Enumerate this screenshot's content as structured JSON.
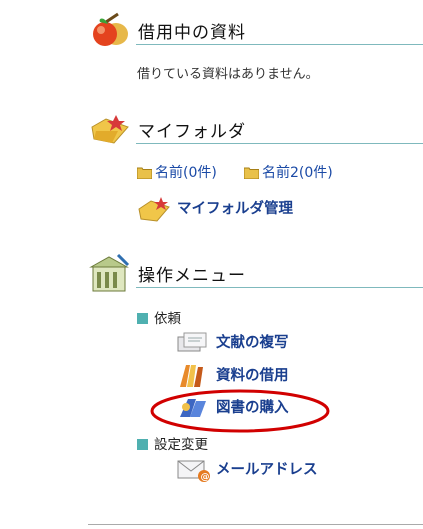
{
  "loans": {
    "title": "借用中の資料",
    "note": "借りている資料はありません。"
  },
  "myfolder": {
    "title": "マイフォルダ",
    "folders": [
      "名前(0件)",
      "名前2(0件)"
    ],
    "manage_label": "マイフォルダ管理"
  },
  "menu": {
    "title": "操作メニュー",
    "request_label": "依頼",
    "request_items": [
      "文献の複写",
      "資料の借用",
      "図書の購入"
    ],
    "settings_label": "設定変更",
    "settings_items": [
      "メールアドレス"
    ]
  },
  "highlight_color": "#d10000",
  "accent_color": "#4fb0b0",
  "icons": [
    "apple-pencil-icon",
    "folder-star-icon",
    "building-icon",
    "folder-icon",
    "documents-icon",
    "books-icon",
    "cart-icon",
    "email-icon"
  ]
}
